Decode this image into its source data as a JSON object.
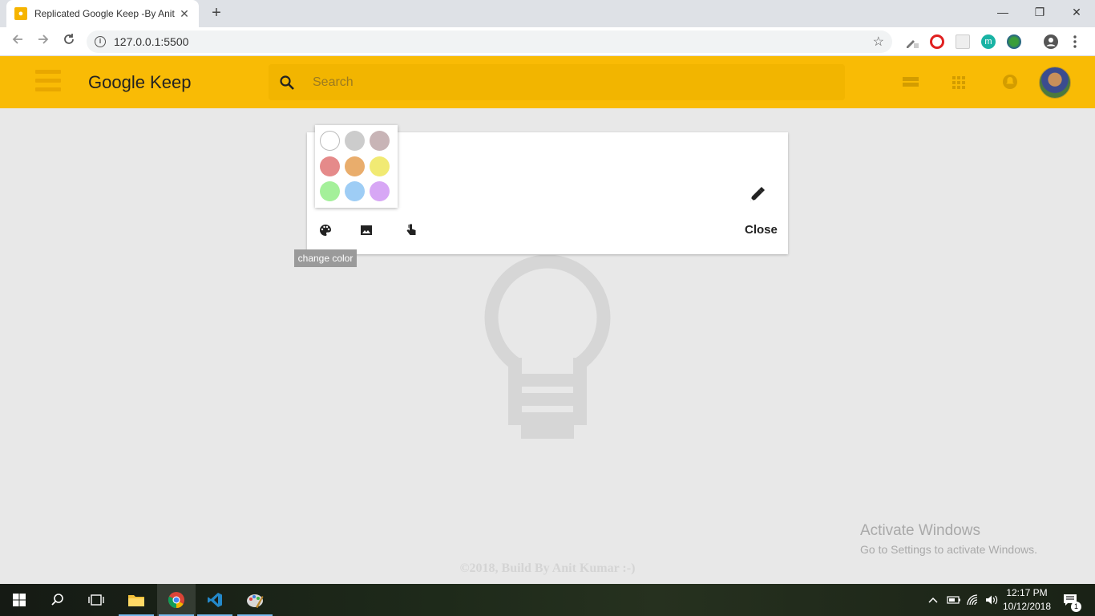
{
  "browser": {
    "tab_title": "Replicated Google Keep -By Anit",
    "tab_close": "✕",
    "new_tab": "+",
    "url": "127.0.0.1:5500",
    "window_controls": {
      "minimize": "—",
      "restore": "❐",
      "close": "✕"
    }
  },
  "appbar": {
    "title": "Google Keep",
    "search_placeholder": "Search",
    "colors": {
      "bar": "#f9bb05",
      "search": "#f2b500"
    }
  },
  "note": {
    "close_label": "Close",
    "tooltip": "change color",
    "swatches": [
      "#ffffff",
      "#cccccc",
      "#c8b4b6",
      "#e58a8a",
      "#e9ad6c",
      "#f1ea73",
      "#a4f09a",
      "#9ecdf5",
      "#d7a7f5"
    ]
  },
  "footer": {
    "copyright": "©2018, Build By Anit Kumar :-)"
  },
  "watermark": {
    "title": "Activate Windows",
    "subtitle": "Go to Settings to activate Windows."
  },
  "taskbar": {
    "time": "12:17 PM",
    "date": "10/12/2018",
    "notification_count": "1"
  }
}
